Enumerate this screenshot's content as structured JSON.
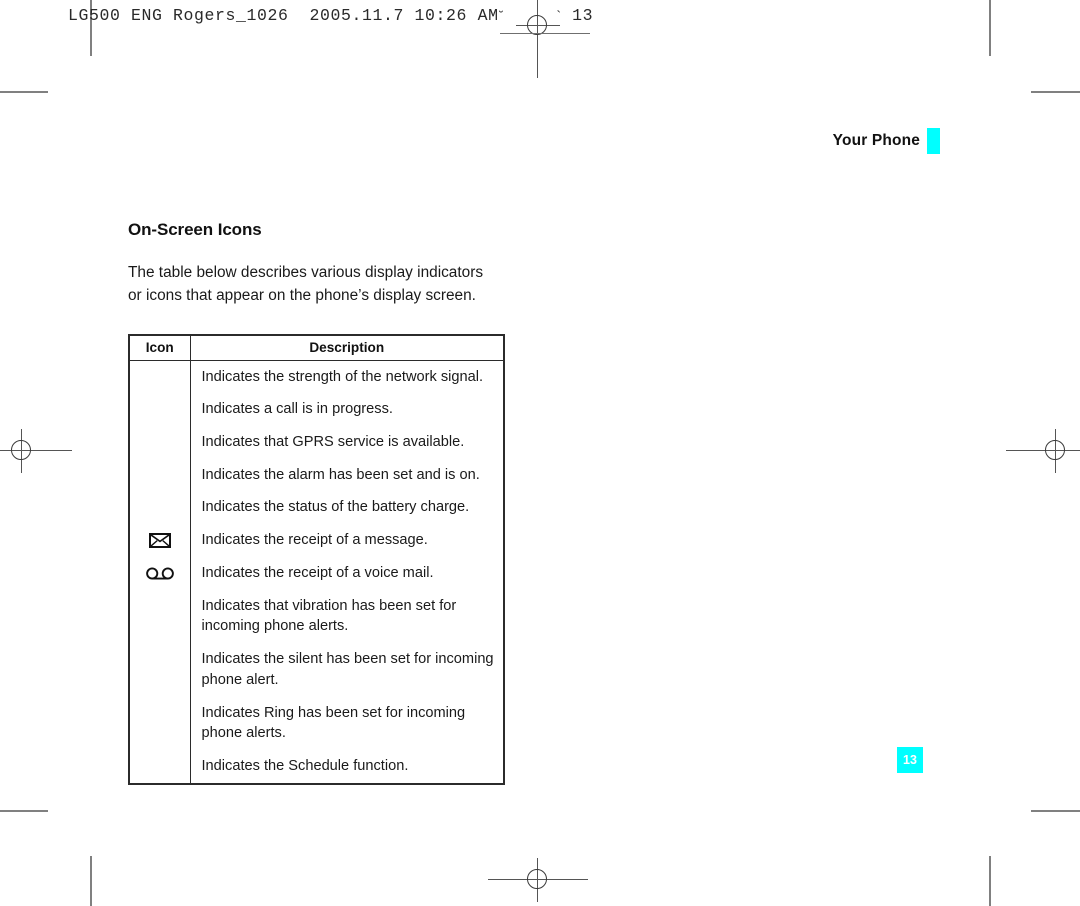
{
  "prepress": {
    "slug_text": "LG500 ENG Rogers_1026  2005.11.7 10:26 AM",
    "slug_mark_left": "˘",
    "slug_mark_right": "ˋ",
    "slug_page": "13"
  },
  "running_head": {
    "label": "Your Phone",
    "accent_color": "#00ffff"
  },
  "section": {
    "title": "On-Screen Icons",
    "intro": "The table below describes various display indicators or icons that appear on the phone’s display screen."
  },
  "table": {
    "headers": {
      "icon": "Icon",
      "description": "Description"
    },
    "rows": [
      {
        "icon": "",
        "description": "Indicates the strength of the network signal."
      },
      {
        "icon": "",
        "description": "Indicates a call is in progress."
      },
      {
        "icon": "",
        "description": "Indicates that GPRS service is available."
      },
      {
        "icon": "",
        "description": "Indicates the alarm has been set and is on."
      },
      {
        "icon": "",
        "description": "Indicates the status of the battery charge."
      },
      {
        "icon": "envelope-icon",
        "description": "Indicates the receipt of a message."
      },
      {
        "icon": "voicemail-icon",
        "description": "Indicates the receipt of a voice mail."
      },
      {
        "icon": "",
        "description": "Indicates that vibration has been set for incoming phone alerts."
      },
      {
        "icon": "",
        "description": "Indicates the silent has been set for incoming phone alert."
      },
      {
        "icon": "",
        "description": "Indicates Ring has been set for incoming phone alerts."
      },
      {
        "icon": "",
        "description": "Indicates the Schedule function."
      }
    ]
  },
  "folio": {
    "page_number": "13",
    "background_color": "#00ffff"
  }
}
